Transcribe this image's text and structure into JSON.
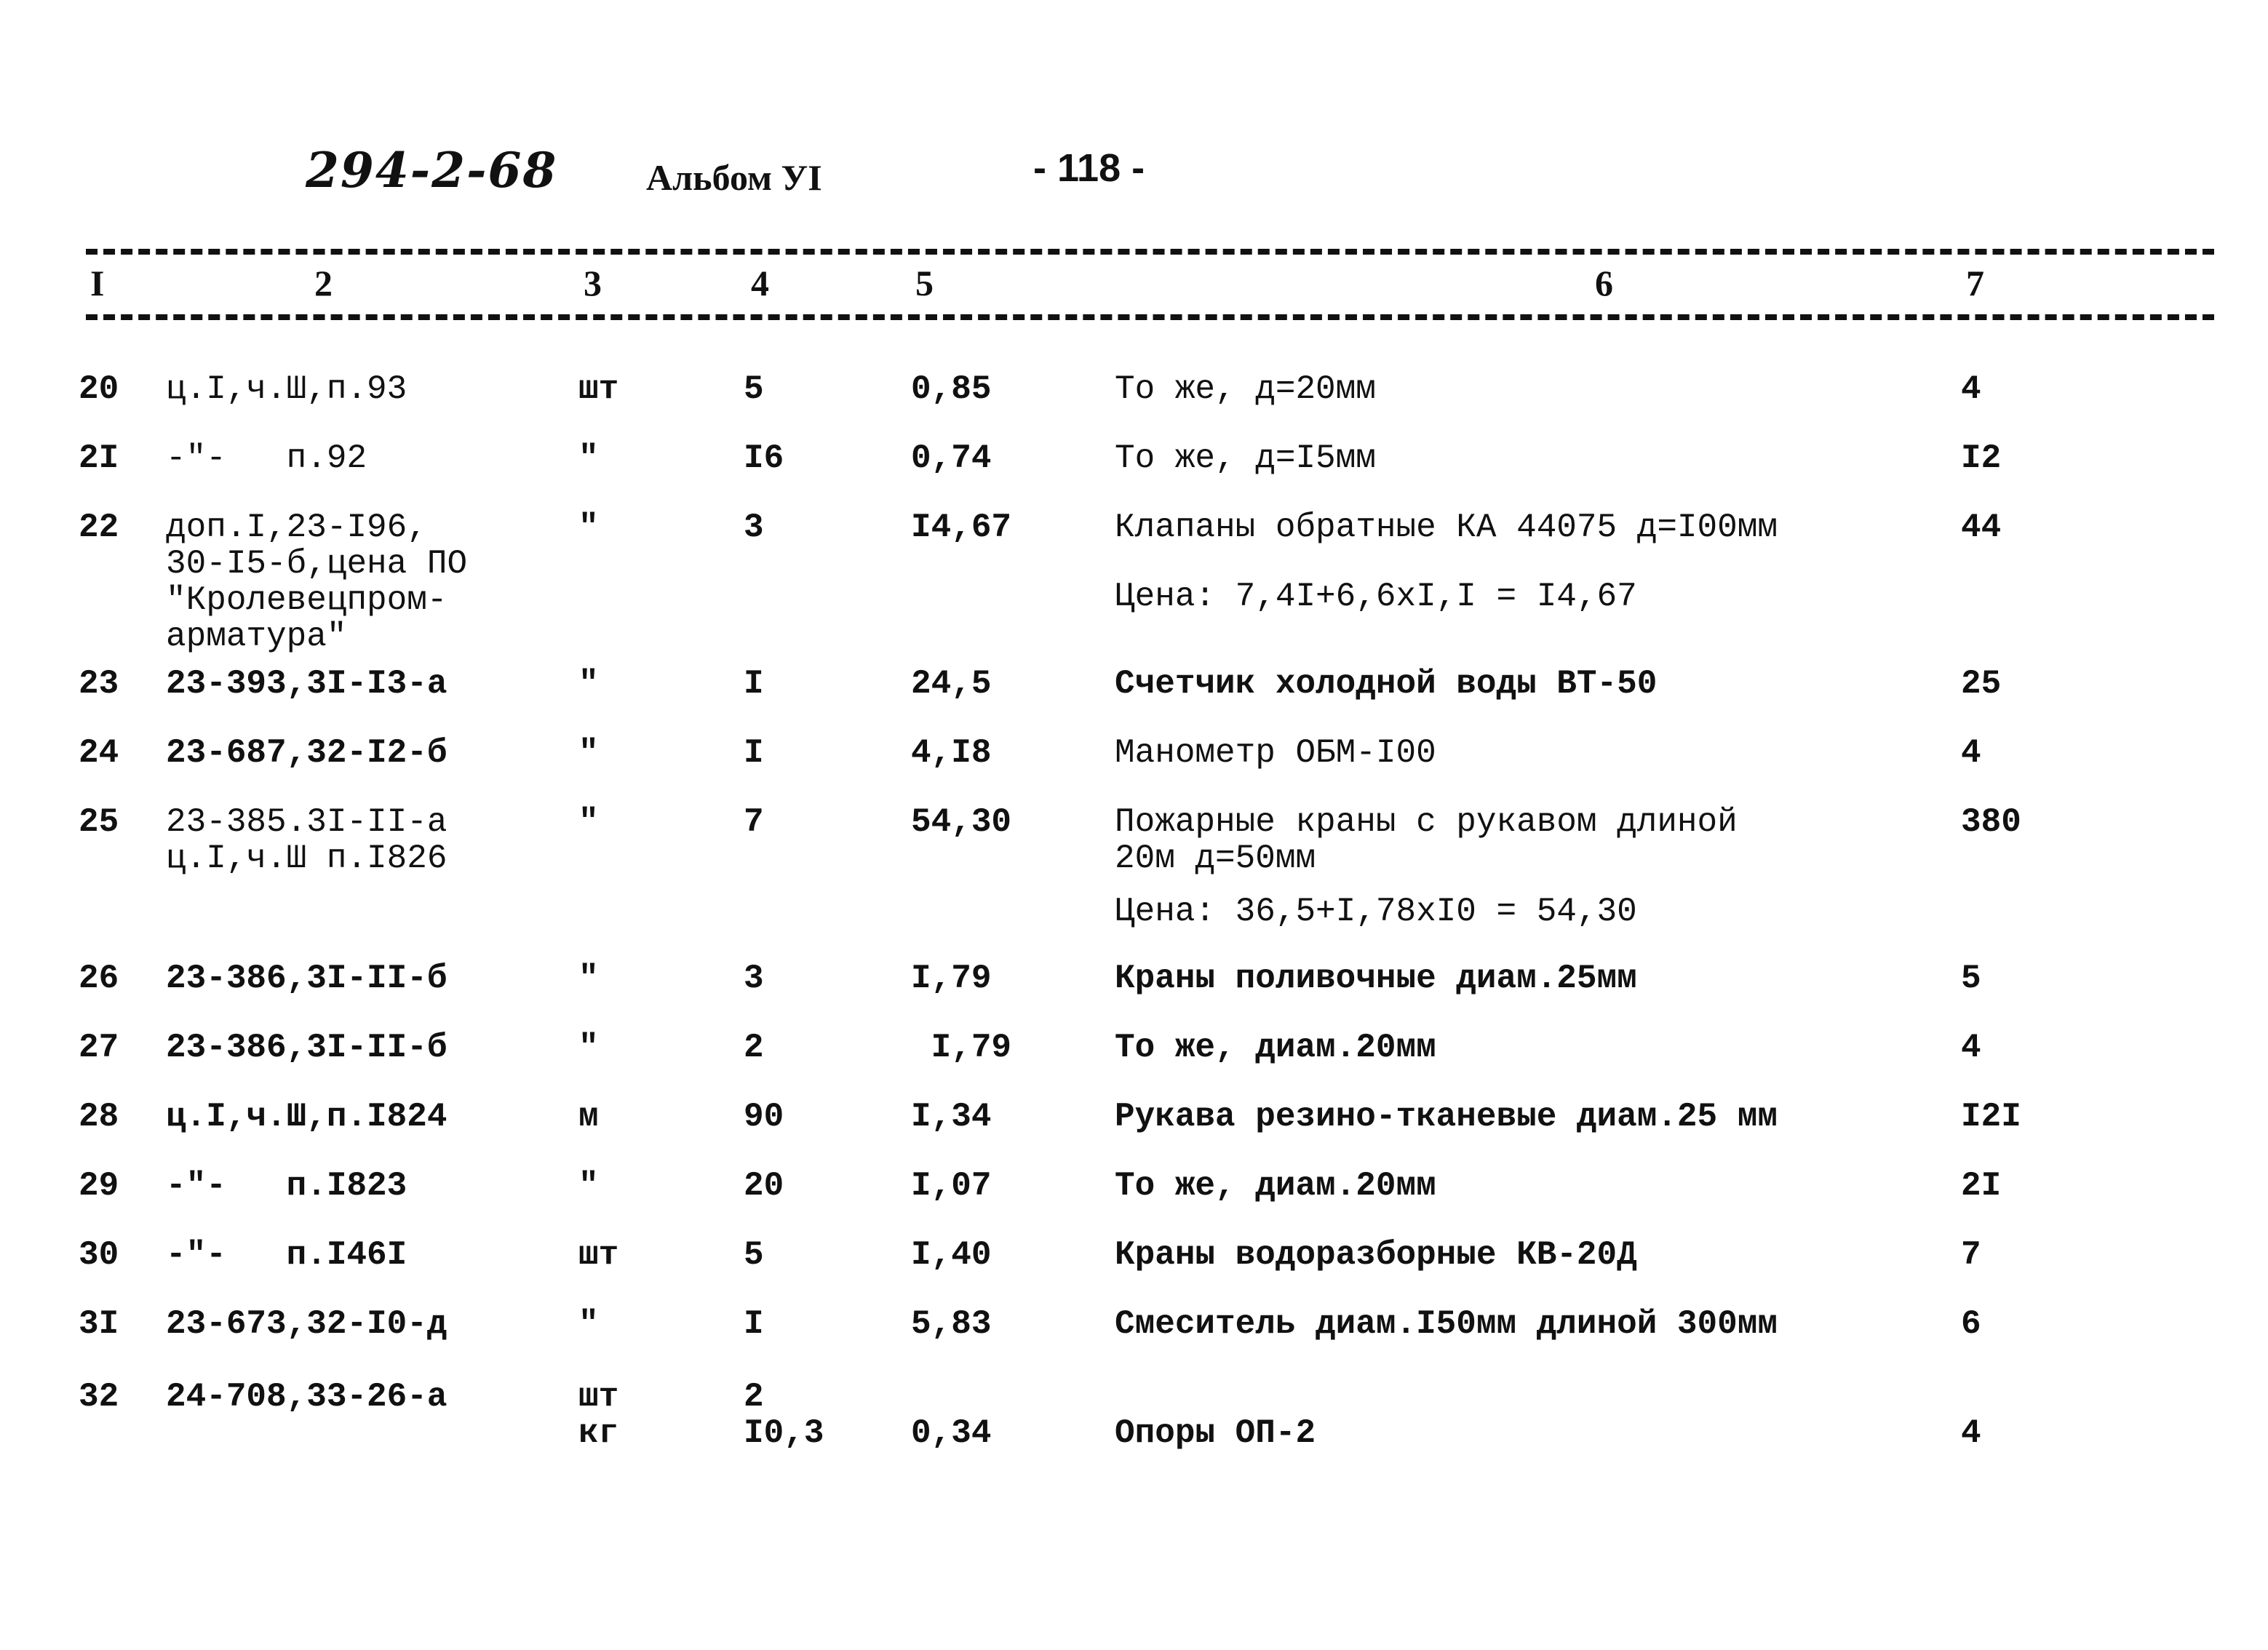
{
  "header": {
    "document_code": "294-2-68",
    "album": "Альбом УI",
    "page_number": "- 118 -"
  },
  "columns": [
    "I",
    "2",
    "3",
    "4",
    "5",
    "6",
    "7"
  ],
  "rows": [
    {
      "n": "20",
      "ref": "ц.I,ч.Ш,п.93",
      "unit": "шт",
      "qty": "5",
      "price": "0,85",
      "desc": "То же, д=20мм",
      "desc2": "",
      "total": "4"
    },
    {
      "n": "2I",
      "ref": "-\"-   п.92",
      "unit": "\"",
      "qty": "I6",
      "price": "0,74",
      "desc": "То же, д=I5мм",
      "desc2": "",
      "total": "I2"
    },
    {
      "n": "22",
      "ref": "доп.I,23-I96,\n30-I5-б,цена ПО\n\"Кролевецпром-\nарматура\"",
      "unit": "\"",
      "qty": "3",
      "price": "I4,67",
      "desc": "Клапаны обратные КА 44075 д=I00мм",
      "desc2": "Цена: 7,4I+6,6хI,I = I4,67",
      "total": "44"
    },
    {
      "n": "23",
      "ref": "23-393,3I-I3-а",
      "unit": "\"",
      "qty": "I",
      "price": "24,5",
      "desc": "Счетчик холодной воды ВТ-50",
      "desc2": "",
      "total": "25"
    },
    {
      "n": "24",
      "ref": "23-687,32-I2-б",
      "unit": "\"",
      "qty": "I",
      "price": "4,I8",
      "desc": "Манометр ОБМ-I00",
      "desc2": "",
      "total": "4"
    },
    {
      "n": "25",
      "ref": "23-385.3I-II-а\nц.I,ч.Ш п.I826",
      "unit": "\"",
      "qty": "7",
      "price": "54,30",
      "desc": "Пожарные краны с рукавом длиной\n20м д=50мм",
      "desc2": "Цена: 36,5+I,78хI0 = 54,30",
      "total": "380"
    },
    {
      "n": "26",
      "ref": "23-386,3I-II-б",
      "unit": "\"",
      "qty": "3",
      "price": "I,79",
      "desc": "Краны поливочные диам.25мм",
      "desc2": "",
      "total": "5"
    },
    {
      "n": "27",
      "ref": "23-386,3I-II-б",
      "unit": "\"",
      "qty": "2",
      "price": " I,79",
      "desc": "То же, диам.20мм",
      "desc2": "",
      "total": "4"
    },
    {
      "n": "28",
      "ref": "ц.I,ч.Ш,п.I824",
      "unit": "м",
      "qty": "90",
      "price": "I,34",
      "desc": "Рукава резино-тканевые диам.25 мм",
      "desc2": "",
      "total": "I2I"
    },
    {
      "n": "29",
      "ref": "-\"-   п.I823",
      "unit": "\"",
      "qty": "20",
      "price": "I,07",
      "desc": "То же, диам.20мм",
      "desc2": "",
      "total": "2I"
    },
    {
      "n": "30",
      "ref": "-\"-   п.I46I",
      "unit": "шт",
      "qty": "5",
      "price": "I,40",
      "desc": "Краны водоразборные КВ-20Д",
      "desc2": "",
      "total": "7"
    },
    {
      "n": "3I",
      "ref": "23-673,32-I0-д",
      "unit": "\"",
      "qty": "I",
      "price": "5,83",
      "desc": "Смеситель диам.I50мм длиной 300мм",
      "desc2": "",
      "total": "6"
    },
    {
      "n": "32",
      "ref": "24-708,33-26-а",
      "unit": "шт\nкг",
      "qty": "2\nI0,3",
      "price": "0,34",
      "desc": "Опоры ОП-2",
      "desc2": "",
      "total": "4"
    }
  ]
}
